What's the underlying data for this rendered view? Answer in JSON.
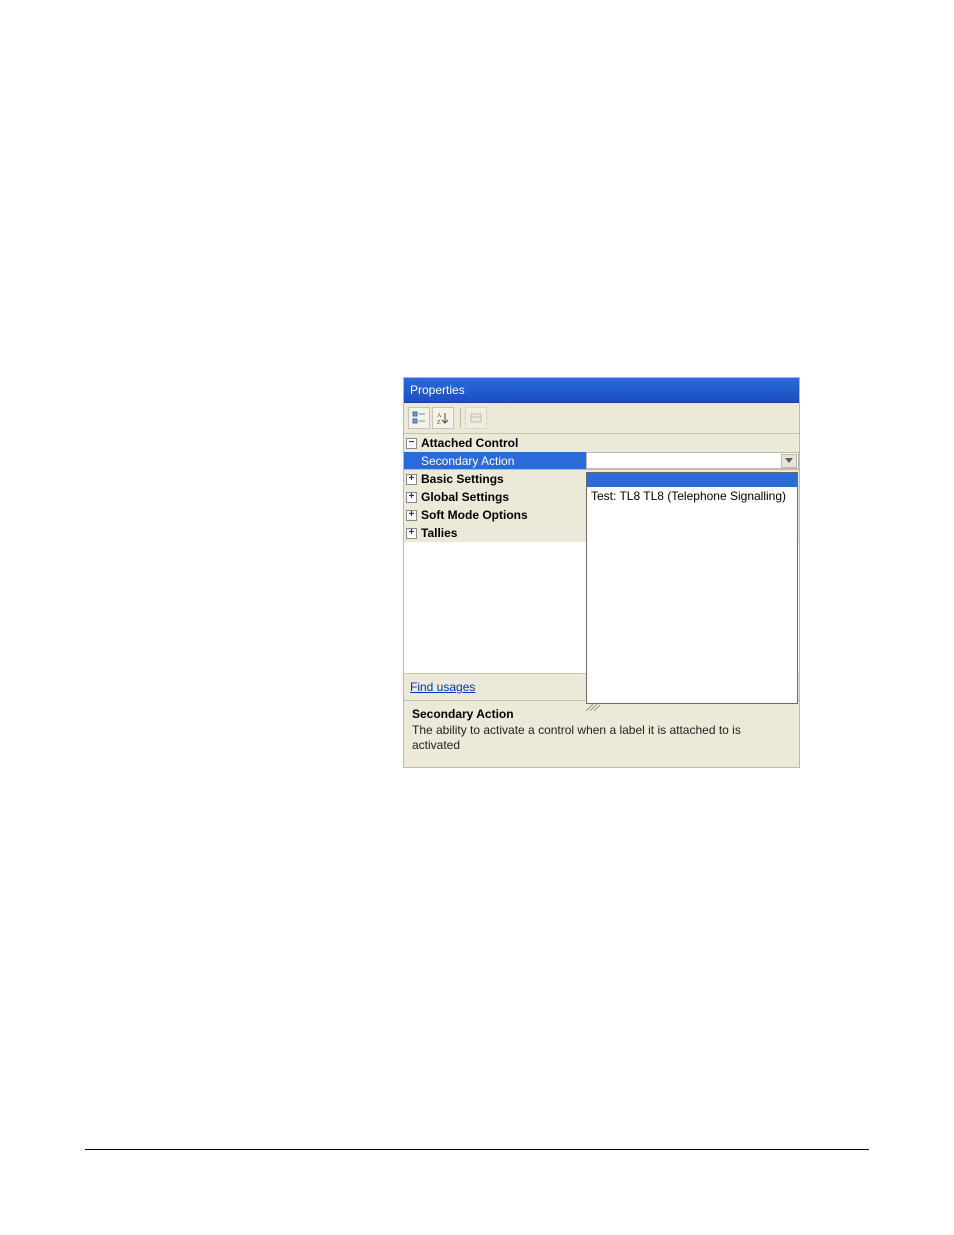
{
  "panel": {
    "title": "Properties"
  },
  "categories": [
    {
      "label": "Attached Control",
      "expanded": true,
      "props": [
        {
          "label": "Secondary Action",
          "value": "",
          "selected": true
        }
      ]
    },
    {
      "label": "Basic Settings",
      "expanded": false
    },
    {
      "label": "Global Settings",
      "expanded": false
    },
    {
      "label": "Soft Mode Options",
      "expanded": false
    },
    {
      "label": "Tallies",
      "expanded": false
    }
  ],
  "dropdown": {
    "options": [
      "",
      "Test: TL8  TL8   (Telephone Signalling)"
    ],
    "selected_index": 0
  },
  "links": {
    "find_usages": "Find usages"
  },
  "description": {
    "title": "Secondary Action",
    "text": "The ability to activate a control when a label it is attached to is activated"
  }
}
